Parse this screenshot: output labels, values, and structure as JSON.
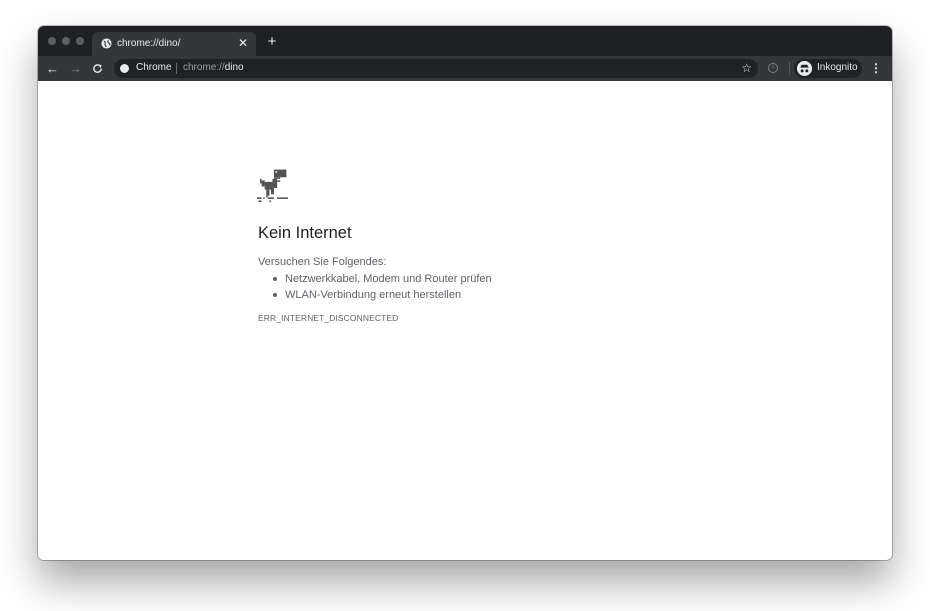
{
  "tab": {
    "title": "chrome://dino/",
    "close_icon": "close-icon",
    "new_tab_icon": "plus-icon"
  },
  "toolbar": {
    "omnibox": {
      "chip": "Chrome",
      "url_scheme": "chrome://",
      "url_host": "dino"
    },
    "profile_label": "Inkognito"
  },
  "page": {
    "heading": "Kein Internet",
    "suggestions_title": "Versuchen Sie Folgendes:",
    "suggestions": [
      "Netzwerkkabel, Modem und Router prüfen",
      "WLAN-Verbindung erneut herstellen"
    ],
    "error_code": "ERR_INTERNET_DISCONNECTED"
  },
  "colors": {
    "tabstrip": "#1f2023",
    "toolbar": "#35363a",
    "omnibox": "#202124",
    "heading_text": "#202124",
    "body_text": "#5f6368",
    "dino": "#535353"
  }
}
